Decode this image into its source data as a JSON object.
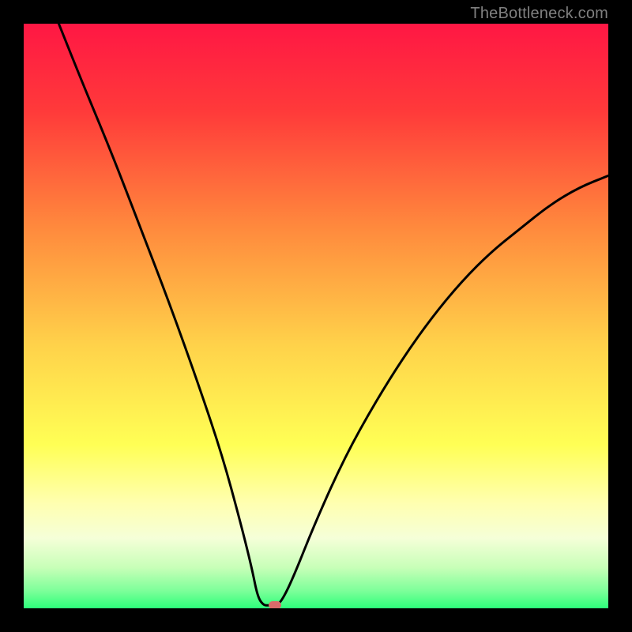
{
  "watermark": "TheBottleneck.com",
  "chart_data": {
    "type": "line",
    "title": "",
    "xlabel": "",
    "ylabel": "",
    "x_range": [
      0,
      100
    ],
    "y_range": [
      0,
      100
    ],
    "curve": {
      "description": "V-shaped bottleneck curve, high at the edges, minimum near x≈42",
      "points": [
        {
          "x": 6,
          "y": 100
        },
        {
          "x": 10,
          "y": 90
        },
        {
          "x": 15,
          "y": 78
        },
        {
          "x": 20,
          "y": 65
        },
        {
          "x": 25,
          "y": 52
        },
        {
          "x": 30,
          "y": 38
        },
        {
          "x": 34,
          "y": 26
        },
        {
          "x": 37,
          "y": 15
        },
        {
          "x": 39,
          "y": 7
        },
        {
          "x": 40,
          "y": 2
        },
        {
          "x": 41,
          "y": 0.5
        },
        {
          "x": 42,
          "y": 0.5
        },
        {
          "x": 43,
          "y": 0.5
        },
        {
          "x": 44,
          "y": 1
        },
        {
          "x": 46,
          "y": 5
        },
        {
          "x": 50,
          "y": 15
        },
        {
          "x": 55,
          "y": 26
        },
        {
          "x": 60,
          "y": 35
        },
        {
          "x": 65,
          "y": 43
        },
        {
          "x": 70,
          "y": 50
        },
        {
          "x": 75,
          "y": 56
        },
        {
          "x": 80,
          "y": 61
        },
        {
          "x": 85,
          "y": 65
        },
        {
          "x": 90,
          "y": 69
        },
        {
          "x": 95,
          "y": 72
        },
        {
          "x": 100,
          "y": 74
        }
      ]
    },
    "marker": {
      "x": 43,
      "y": 0.5,
      "color": "#d96a6a"
    },
    "gradient_stops": [
      {
        "offset": 0,
        "color": "#ff1744"
      },
      {
        "offset": 15,
        "color": "#ff3a3a"
      },
      {
        "offset": 35,
        "color": "#ff8a3d"
      },
      {
        "offset": 55,
        "color": "#ffd24a"
      },
      {
        "offset": 72,
        "color": "#ffff55"
      },
      {
        "offset": 82,
        "color": "#ffffb0"
      },
      {
        "offset": 88,
        "color": "#f5ffd8"
      },
      {
        "offset": 93,
        "color": "#c8ffb8"
      },
      {
        "offset": 97,
        "color": "#7dff9a"
      },
      {
        "offset": 100,
        "color": "#2dff7a"
      }
    ]
  }
}
